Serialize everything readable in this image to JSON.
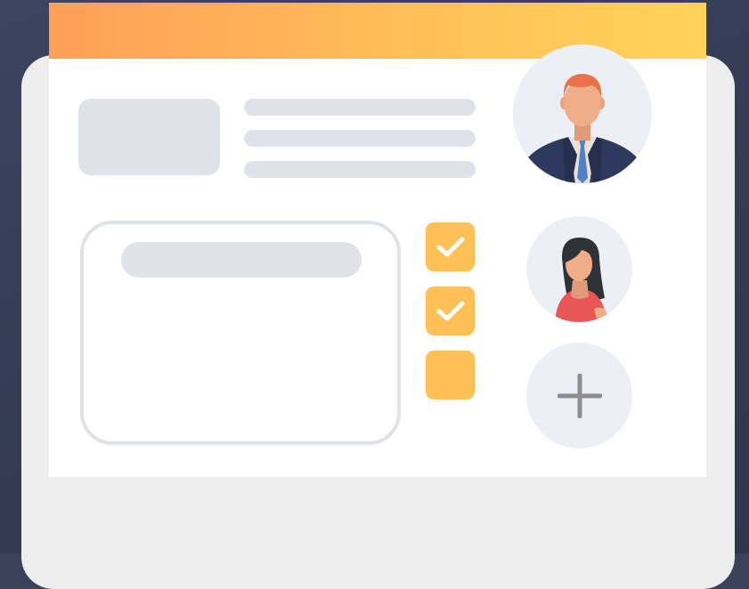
{
  "colors": {
    "background": "#3a4159",
    "device": "#eeeeee",
    "screen": "#ffffff",
    "header_gradient_start": "#ff9f58",
    "header_gradient_end": "#ffd35a",
    "placeholder": "#dfe2e9",
    "checkbox": "#ffc055",
    "avatar_bg": "#eceff6",
    "plus": "#8e8e8e"
  },
  "checklist": [
    {
      "checked": true
    },
    {
      "checked": true
    },
    {
      "checked": false
    }
  ],
  "team": {
    "members": [
      {
        "icon": "male-user-avatar-icon"
      },
      {
        "icon": "female-user-avatar-icon"
      }
    ],
    "add_icon": "plus-icon"
  }
}
